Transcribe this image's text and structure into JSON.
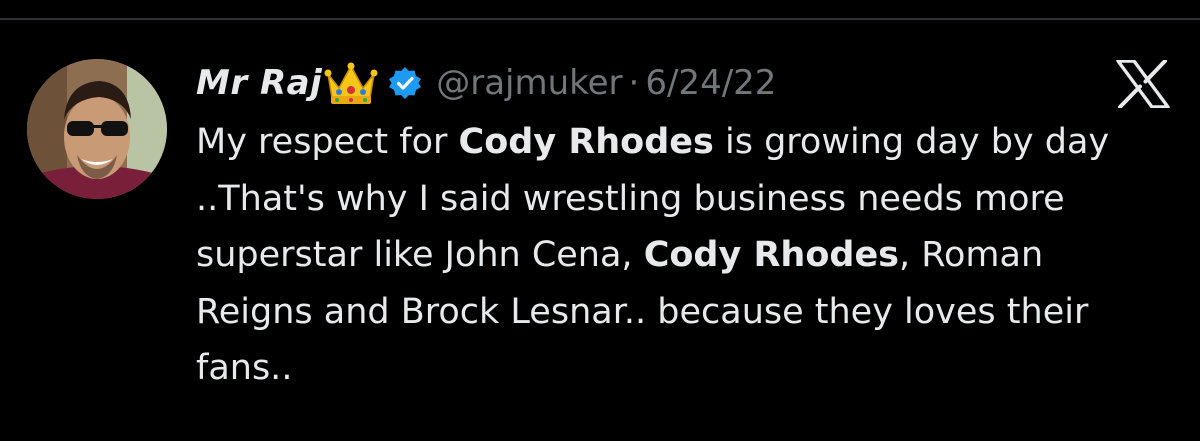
{
  "colors": {
    "background": "#000000",
    "text": "#e7e9ea",
    "muted": "#71767b",
    "verified_badge": "#1d9bf0"
  },
  "author": {
    "display_name": "Mr Raj",
    "name_emoji": "crown",
    "verified": true,
    "handle": "@rajmuker",
    "separator": "·",
    "date": "6/24/22"
  },
  "icons": {
    "avatar": "profile-photo",
    "verified": "verified-badge-icon",
    "brand": "x-logo-icon"
  },
  "tweet": {
    "segments": [
      {
        "text": "My respect for ",
        "bold": false
      },
      {
        "text": "Cody Rhodes",
        "bold": true
      },
      {
        "text": " is growing day by day ..That's why I said wrestling business needs more superstar like John Cena, ",
        "bold": false
      },
      {
        "text": "Cody Rhodes",
        "bold": true
      },
      {
        "text": ", Roman Reigns and Brock Lesnar.. because they loves their fans..",
        "bold": false
      }
    ]
  }
}
